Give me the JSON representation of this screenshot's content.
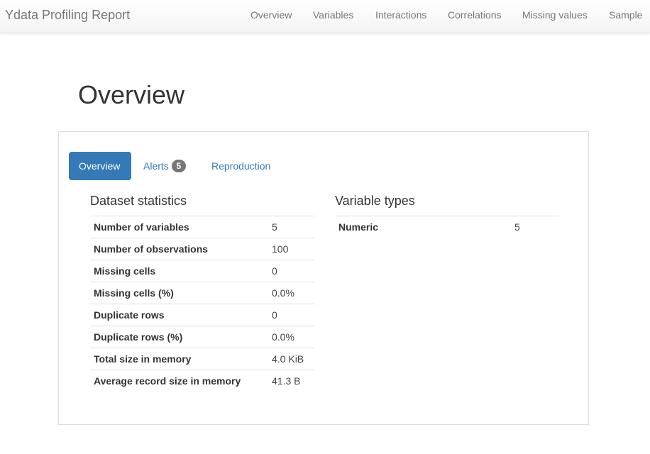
{
  "navbar": {
    "brand": "Ydata Profiling Report",
    "links": [
      {
        "label": "Overview"
      },
      {
        "label": "Variables"
      },
      {
        "label": "Interactions"
      },
      {
        "label": "Correlations"
      },
      {
        "label": "Missing values"
      },
      {
        "label": "Sample"
      }
    ]
  },
  "page_title": "Overview",
  "tabs": [
    {
      "label": "Overview",
      "active": true
    },
    {
      "label": "Alerts",
      "badge": "5"
    },
    {
      "label": "Reproduction"
    }
  ],
  "dataset_statistics": {
    "title": "Dataset statistics",
    "rows": [
      {
        "label": "Number of variables",
        "value": "5"
      },
      {
        "label": "Number of observations",
        "value": "100"
      },
      {
        "label": "Missing cells",
        "value": "0"
      },
      {
        "label": "Missing cells (%)",
        "value": "0.0%"
      },
      {
        "label": "Duplicate rows",
        "value": "0"
      },
      {
        "label": "Duplicate rows (%)",
        "value": "0.0%"
      },
      {
        "label": "Total size in memory",
        "value": "4.0 KiB"
      },
      {
        "label": "Average record size in memory",
        "value": "41.3 B"
      }
    ]
  },
  "variable_types": {
    "title": "Variable types",
    "rows": [
      {
        "label": "Numeric",
        "value": "5"
      }
    ]
  },
  "colors": {
    "accent": "#337ab7",
    "badge": "#777777",
    "nav_text": "#777777"
  }
}
